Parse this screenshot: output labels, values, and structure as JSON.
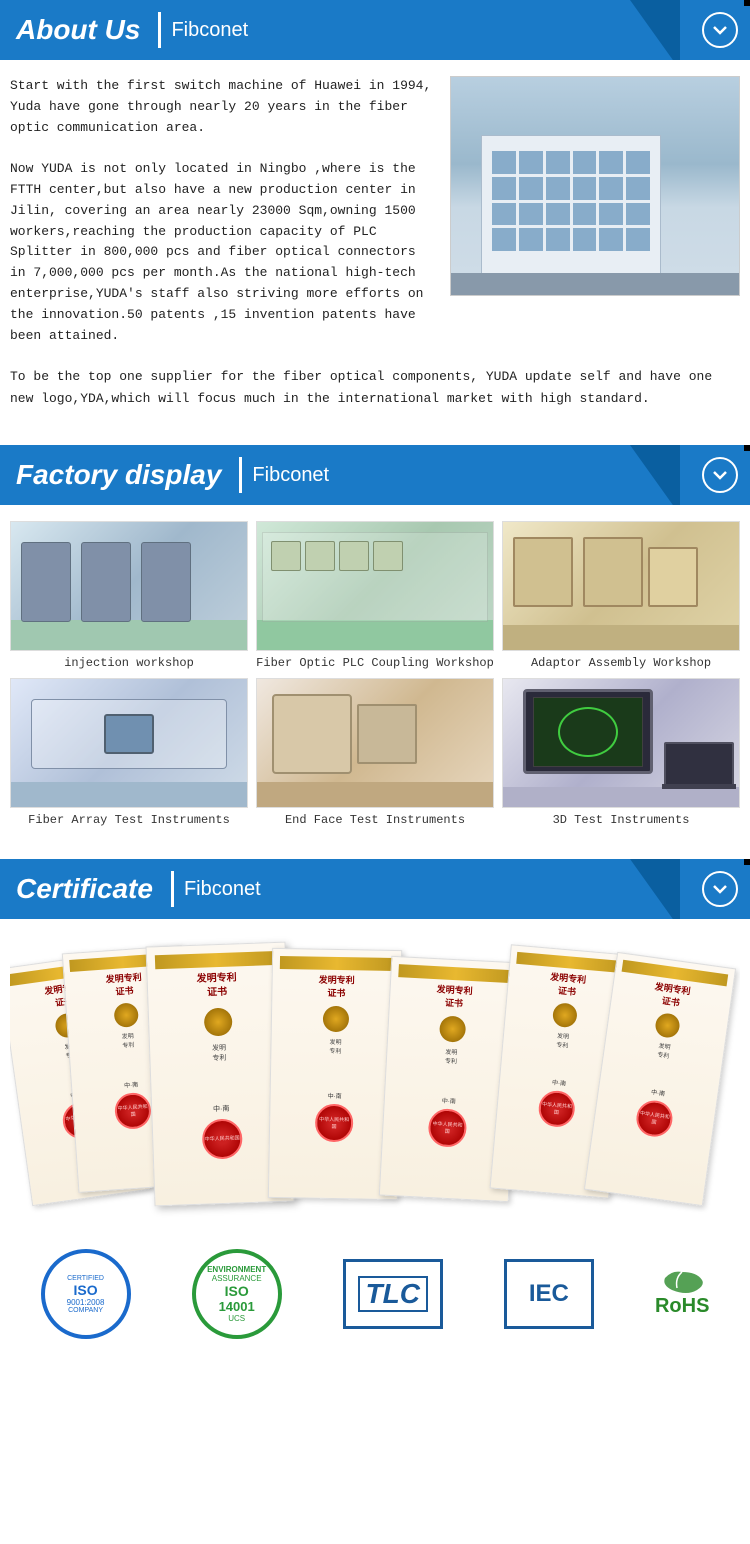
{
  "about": {
    "section_title": "About Us",
    "section_subtitle": "Fibconet",
    "paragraph1": "Start with the first switch machine of Huawei in 1994, Yuda have gone through nearly 20 years in the fiber optic communication area.",
    "paragraph2": "Now YUDA is not only located in Ningbo ,where is the FTTH center,but also have a new production center in Jilin, covering an area nearly 23000 Sqm,owning 1500 workers,reaching the production capacity  of  PLC Splitter in 800,000 pcs and fiber optical connectors in 7,000,000 pcs per month.As the national high-tech enterprise,YUDA's staff also striving more efforts on the innovation.50 patents ,15 invention patents have been attained.",
    "paragraph3": "To be the top one supplier for the fiber optical components, YUDA update self and have one new logo,YDA,which will focus much in the international market with high standard."
  },
  "factory": {
    "section_title": "Factory display",
    "section_subtitle": "Fibconet",
    "workshops": [
      {
        "id": 1,
        "caption": "injection workshop",
        "style": "injection"
      },
      {
        "id": 2,
        "caption": "Fiber Optic PLC Coupling Workshop",
        "style": "plc"
      },
      {
        "id": 3,
        "caption": "Adaptor Assembly Workshop",
        "style": "adaptor"
      },
      {
        "id": 4,
        "caption": "Fiber Array Test Instruments",
        "style": "array"
      },
      {
        "id": 5,
        "caption": "End Face Test Instruments",
        "style": "endface"
      },
      {
        "id": 6,
        "caption": "3D Test Instruments",
        "style": "3d"
      }
    ]
  },
  "certificate": {
    "section_title": "Certificate",
    "section_subtitle": "Fibconet",
    "certs": [
      {
        "id": 1,
        "title": "发明专利证书"
      },
      {
        "id": 2,
        "title": "发明专利证书"
      },
      {
        "id": 3,
        "title": "发明专利证书"
      },
      {
        "id": 4,
        "title": "发明专利证书"
      },
      {
        "id": 5,
        "title": "发明专利证书"
      },
      {
        "id": 6,
        "title": "发明专利证书"
      },
      {
        "id": 7,
        "title": "发明专利证书"
      }
    ],
    "badges": [
      {
        "id": "iso9001",
        "label": "CERTIFIED",
        "number": "ISO",
        "year": "9001:2008",
        "sub": "COMPANY"
      },
      {
        "id": "iso14001",
        "label": "ISO",
        "number": "14001",
        "sub": "UCS"
      },
      {
        "id": "tlc",
        "label": "TLC"
      },
      {
        "id": "iec",
        "label": "IEC"
      },
      {
        "id": "rohs",
        "label": "RoHS"
      }
    ]
  },
  "icons": {
    "chevron_down": "chevron-down-icon",
    "chevron_symbol": "⌄"
  }
}
